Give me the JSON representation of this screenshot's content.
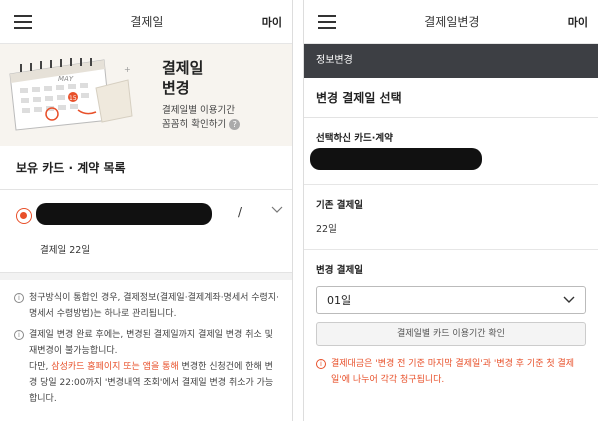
{
  "left": {
    "header": {
      "title": "결제일",
      "my_label": "마이"
    },
    "banner": {
      "title_line1": "결제일",
      "title_line2": "변경",
      "sub_line1": "결제일별 이용기간",
      "sub_line2": "꼼꼼히 확인하기",
      "calendar_month": "MAY",
      "calendar_day": "15",
      "help_glyph": "?"
    },
    "section_title": "보유 카드 · 계약 목록",
    "card": {
      "separator": "/",
      "payday": "결제일 22일"
    },
    "notes": [
      {
        "text": "청구방식이 통합인 경우, 결제정보(결제일·결제계좌·명세서 수령지·명세서 수령방법)는 하나로 관리됩니다."
      },
      {
        "text": "결제일 변경 완료 후에는, 변경된 결제일까지 결제일 변경 취소 및 재변경이 불가능합니다."
      },
      {
        "pre": "다만, ",
        "highlight": "삼성카드 홈페이지 또는 앱을 통해",
        "post": " 변경한 신청건에 한해 변경 당일 22:00까지 '변경내역 조회'에서 결제일 변경 취소가 가능합니다."
      }
    ],
    "info_glyph": "i"
  },
  "right": {
    "header": {
      "title": "결제일변경",
      "my_label": "마이"
    },
    "dark_bar": "정보변경",
    "section_title": "변경 결제일 선택",
    "selected_label": "선택하신 카드·계약",
    "current_label": "기존 결제일",
    "current_value": "22일",
    "new_label": "변경 결제일",
    "select_value": "01일",
    "check_button": "결제일별 카드 이용기간 확인",
    "note": "결제대금은 '변경 전 기준 마지막 결제일'과 '변경 후 기준 첫 결제일'에 나누어 각각 청구됩니다.",
    "info_glyph": "i"
  },
  "colors": {
    "accent": "#e8502a",
    "dark_bar": "#3d3f44",
    "banner_bg": "#f7f4ef"
  },
  "icons": [
    "menu-icon",
    "calendar-illustration",
    "help-icon",
    "radio-selected-icon",
    "chevron-down-icon",
    "info-icon"
  ]
}
